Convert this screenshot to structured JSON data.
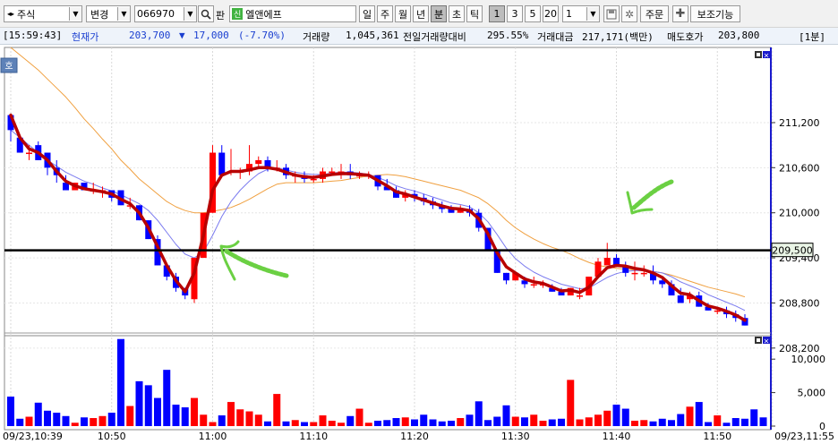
{
  "toolbar": {
    "market_type": "주식",
    "change_label": "변경",
    "stock_code": "066970",
    "search_label": "판",
    "credit_badge": "신",
    "stock_name": "엘앤에프",
    "periods": [
      "일",
      "주",
      "월",
      "년",
      "분",
      "초",
      "틱"
    ],
    "active_period": "분",
    "intervals": [
      "1",
      "3",
      "5",
      "20"
    ],
    "active_interval": "1",
    "interval_value": "1",
    "order_label": "주문",
    "aux_label": "보조기능"
  },
  "info": {
    "time": "[15:59:43]",
    "price_label": "현재가",
    "price": "203,700",
    "change_arrow": "▼",
    "change": "17,000",
    "change_pct": "(-7.70%)",
    "volume_label": "거래량",
    "volume": "1,045,361",
    "prev_ratio_label": "전일거래량대비",
    "prev_ratio": "295.55%",
    "amount_label": "거래대금",
    "amount": "217,171(백만)",
    "ask_label": "매도호가",
    "ask": "203,800",
    "timeframe": "[1분]"
  },
  "chart_data": {
    "type": "candlestick",
    "price_axis": {
      "ylim": [
        207900,
        212200
      ],
      "ticks": [
        208200,
        208800,
        209400,
        210000,
        210600,
        211200
      ],
      "tick_labels": [
        "208,200",
        "208,800",
        "209,400",
        "210,000",
        "210,600",
        "211,200"
      ]
    },
    "volume_axis": {
      "ylim": [
        0,
        13500
      ],
      "ticks": [
        0,
        5000,
        10000
      ],
      "tick_labels": [
        "0",
        "5,000",
        "10,000"
      ]
    },
    "x_labels": [
      "09/23,10:39",
      "10:50",
      "11:00",
      "11:10",
      "11:20",
      "11:30",
      "11:40",
      "11:50",
      "09/23,11:55"
    ],
    "x_label_minutes": [
      0,
      11,
      22,
      33,
      44,
      55,
      66,
      77,
      83
    ],
    "horizontal_line": {
      "value": 209500,
      "label": "209,500"
    },
    "corner_badge": "호",
    "candles": [
      {
        "o": 211300,
        "h": 211300,
        "l": 210950,
        "c": 211100
      },
      {
        "o": 211000,
        "h": 211000,
        "l": 210800,
        "c": 210800
      },
      {
        "o": 210800,
        "h": 210900,
        "l": 210700,
        "c": 210800
      },
      {
        "o": 210900,
        "h": 210950,
        "l": 210700,
        "c": 210700
      },
      {
        "o": 210800,
        "h": 210800,
        "l": 210500,
        "c": 210600
      },
      {
        "o": 210600,
        "h": 210700,
        "l": 210400,
        "c": 210500
      },
      {
        "o": 210400,
        "h": 210500,
        "l": 210300,
        "c": 210300
      },
      {
        "o": 210300,
        "h": 210400,
        "l": 210300,
        "c": 210400
      },
      {
        "o": 210400,
        "h": 210400,
        "l": 210300,
        "c": 210300
      },
      {
        "o": 210300,
        "h": 210400,
        "l": 210250,
        "c": 210300
      },
      {
        "o": 210300,
        "h": 210350,
        "l": 210200,
        "c": 210300
      },
      {
        "o": 210300,
        "h": 210300,
        "l": 210150,
        "c": 210200
      },
      {
        "o": 210300,
        "h": 210300,
        "l": 210100,
        "c": 210100
      },
      {
        "o": 210100,
        "h": 210200,
        "l": 210050,
        "c": 210100
      },
      {
        "o": 210100,
        "h": 210100,
        "l": 209900,
        "c": 209900
      },
      {
        "o": 209900,
        "h": 209900,
        "l": 209650,
        "c": 209650
      },
      {
        "o": 209650,
        "h": 209700,
        "l": 209300,
        "c": 209300
      },
      {
        "o": 209300,
        "h": 209300,
        "l": 209100,
        "c": 209150
      },
      {
        "o": 209150,
        "h": 209200,
        "l": 208950,
        "c": 209000
      },
      {
        "o": 209000,
        "h": 209000,
        "l": 208850,
        "c": 208900
      },
      {
        "o": 208850,
        "h": 209400,
        "l": 208800,
        "c": 209400
      },
      {
        "o": 209400,
        "h": 210000,
        "l": 209400,
        "c": 210000
      },
      {
        "o": 210000,
        "h": 210900,
        "l": 210000,
        "c": 210800
      },
      {
        "o": 210800,
        "h": 210900,
        "l": 210500,
        "c": 210500
      },
      {
        "o": 210550,
        "h": 210850,
        "l": 210500,
        "c": 210550
      },
      {
        "o": 210550,
        "h": 210600,
        "l": 210450,
        "c": 210550
      },
      {
        "o": 210550,
        "h": 210900,
        "l": 210500,
        "c": 210650
      },
      {
        "o": 210650,
        "h": 210750,
        "l": 210600,
        "c": 210700
      },
      {
        "o": 210700,
        "h": 210750,
        "l": 210550,
        "c": 210600
      },
      {
        "o": 210600,
        "h": 210700,
        "l": 210550,
        "c": 210600
      },
      {
        "o": 210600,
        "h": 210650,
        "l": 210450,
        "c": 210500
      },
      {
        "o": 210500,
        "h": 210550,
        "l": 210400,
        "c": 210500
      },
      {
        "o": 210500,
        "h": 210550,
        "l": 210400,
        "c": 210450
      },
      {
        "o": 210450,
        "h": 210500,
        "l": 210400,
        "c": 210450
      },
      {
        "o": 210450,
        "h": 210600,
        "l": 210400,
        "c": 210550
      },
      {
        "o": 210550,
        "h": 210600,
        "l": 210500,
        "c": 210550
      },
      {
        "o": 210550,
        "h": 210650,
        "l": 210450,
        "c": 210550
      },
      {
        "o": 210550,
        "h": 210650,
        "l": 210450,
        "c": 210500
      },
      {
        "o": 210500,
        "h": 210550,
        "l": 210450,
        "c": 210500
      },
      {
        "o": 210500,
        "h": 210550,
        "l": 210450,
        "c": 210500
      },
      {
        "o": 210500,
        "h": 210500,
        "l": 210300,
        "c": 210350
      },
      {
        "o": 210350,
        "h": 210450,
        "l": 210300,
        "c": 210300
      },
      {
        "o": 210300,
        "h": 210350,
        "l": 210200,
        "c": 210200
      },
      {
        "o": 210200,
        "h": 210300,
        "l": 210150,
        "c": 210250
      },
      {
        "o": 210250,
        "h": 210300,
        "l": 210150,
        "c": 210200
      },
      {
        "o": 210200,
        "h": 210250,
        "l": 210100,
        "c": 210150
      },
      {
        "o": 210150,
        "h": 210200,
        "l": 210050,
        "c": 210100
      },
      {
        "o": 210100,
        "h": 210150,
        "l": 210000,
        "c": 210050
      },
      {
        "o": 210050,
        "h": 210100,
        "l": 210000,
        "c": 210000
      },
      {
        "o": 210000,
        "h": 210100,
        "l": 210000,
        "c": 210050
      },
      {
        "o": 210050,
        "h": 210100,
        "l": 209950,
        "c": 210000
      },
      {
        "o": 210000,
        "h": 210050,
        "l": 209750,
        "c": 209800
      },
      {
        "o": 209800,
        "h": 209800,
        "l": 209500,
        "c": 209500
      },
      {
        "o": 209500,
        "h": 209500,
        "l": 209200,
        "c": 209200
      },
      {
        "o": 209200,
        "h": 209200,
        "l": 209050,
        "c": 209100
      },
      {
        "o": 209100,
        "h": 209200,
        "l": 209100,
        "c": 209200
      },
      {
        "o": 209100,
        "h": 209150,
        "l": 209000,
        "c": 209050
      },
      {
        "o": 209050,
        "h": 209150,
        "l": 209000,
        "c": 209050
      },
      {
        "o": 209050,
        "h": 209100,
        "l": 209000,
        "c": 209050
      },
      {
        "o": 209000,
        "h": 209050,
        "l": 208950,
        "c": 208950
      },
      {
        "o": 208950,
        "h": 209000,
        "l": 208900,
        "c": 208900
      },
      {
        "o": 208900,
        "h": 209000,
        "l": 208900,
        "c": 209000
      },
      {
        "o": 208900,
        "h": 209000,
        "l": 208850,
        "c": 208900
      },
      {
        "o": 208900,
        "h": 209150,
        "l": 208900,
        "c": 209150
      },
      {
        "o": 209150,
        "h": 209400,
        "l": 209150,
        "c": 209350
      },
      {
        "o": 209300,
        "h": 209600,
        "l": 209300,
        "c": 209400
      },
      {
        "o": 209400,
        "h": 209450,
        "l": 209300,
        "c": 209300
      },
      {
        "o": 209300,
        "h": 209350,
        "l": 209150,
        "c": 209200
      },
      {
        "o": 209200,
        "h": 209350,
        "l": 209100,
        "c": 209200
      },
      {
        "o": 209200,
        "h": 209300,
        "l": 209150,
        "c": 209200
      },
      {
        "o": 209200,
        "h": 209300,
        "l": 209050,
        "c": 209100
      },
      {
        "o": 209100,
        "h": 209150,
        "l": 209000,
        "c": 209050
      },
      {
        "o": 209050,
        "h": 209100,
        "l": 208900,
        "c": 208900
      },
      {
        "o": 208900,
        "h": 209000,
        "l": 208800,
        "c": 208800
      },
      {
        "o": 208850,
        "h": 208950,
        "l": 208800,
        "c": 208900
      },
      {
        "o": 208900,
        "h": 208950,
        "l": 208750,
        "c": 208750
      },
      {
        "o": 208750,
        "h": 208800,
        "l": 208700,
        "c": 208700
      },
      {
        "o": 208700,
        "h": 208750,
        "l": 208650,
        "c": 208700
      },
      {
        "o": 208700,
        "h": 208750,
        "l": 208600,
        "c": 208650
      },
      {
        "o": 208650,
        "h": 208700,
        "l": 208550,
        "c": 208600
      },
      {
        "o": 208600,
        "h": 208650,
        "l": 208500,
        "c": 208500
      }
    ],
    "volume": [
      4400,
      1100,
      1400,
      3500,
      2300,
      2000,
      1500,
      500,
      1300,
      1200,
      1500,
      2000,
      13000,
      3000,
      6700,
      6100,
      4200,
      8400,
      3200,
      2800,
      4200,
      1700,
      600,
      1600,
      3600,
      2500,
      2200,
      1700,
      700,
      4800,
      700,
      900,
      600,
      600,
      1600,
      800,
      500,
      1500,
      2600,
      500,
      800,
      900,
      1200,
      1300,
      1000,
      1700,
      1000,
      700,
      800,
      1200,
      1700,
      3700,
      900,
      1400,
      3100,
      1400,
      1300,
      1700,
      800,
      1000,
      1100,
      6900,
      1000,
      1300,
      1700,
      2300,
      3200,
      2600,
      800,
      900,
      700,
      1100,
      900,
      1800,
      2900,
      3600,
      600,
      1600,
      500,
      1200,
      1100,
      2500,
      1300
    ],
    "ma_thick_red": [
      211300,
      211000,
      210850,
      210800,
      210700,
      210550,
      210420,
      210360,
      210320,
      210300,
      210280,
      210250,
      210180,
      210120,
      210000,
      209800,
      209550,
      209300,
      209100,
      208950,
      209200,
      209700,
      210300,
      210500,
      210550,
      210550,
      210570,
      210600,
      210600,
      210580,
      210540,
      210500,
      210480,
      210470,
      210490,
      210510,
      210520,
      210520,
      210510,
      210500,
      210430,
      210360,
      210280,
      210250,
      210210,
      210170,
      210130,
      210090,
      210060,
      210050,
      210030,
      209920,
      209720,
      209470,
      209280,
      209200,
      209120,
      209080,
      209060,
      209010,
      208960,
      208970,
      208940,
      209010,
      209150,
      209270,
      209300,
      209290,
      209260,
      209240,
      209200,
      209140,
      209030,
      208930,
      208910,
      208830,
      208760,
      208730,
      208690,
      208640,
      208570
    ],
    "ma_blue": [
      211100,
      211000,
      210900,
      210800,
      210700,
      210620,
      210540,
      210480,
      210420,
      210380,
      210330,
      210290,
      210240,
      210180,
      210120,
      210030,
      209900,
      209740,
      209580,
      209450,
      209400,
      209480,
      209700,
      209950,
      210150,
      210300,
      210420,
      210520,
      210580,
      210600,
      210570,
      210540,
      210520,
      210510,
      210510,
      210530,
      210540,
      210540,
      210530,
      210510,
      210470,
      210420,
      210360,
      210320,
      210290,
      210250,
      210210,
      210170,
      210130,
      210110,
      210080,
      210000,
      209880,
      209710,
      209530,
      209390,
      209290,
      209210,
      209150,
      209100,
      209050,
      209020,
      208990,
      209000,
      209070,
      209140,
      209190,
      209220,
      209230,
      209230,
      209220,
      209200,
      209150,
      209080,
      209030,
      208980,
      208910,
      208860,
      208810,
      208760,
      208700
    ],
    "ma_orange": [
      212200,
      212100,
      212000,
      211900,
      211780,
      211660,
      211540,
      211400,
      211250,
      211120,
      210980,
      210850,
      210700,
      210580,
      210450,
      210350,
      210250,
      210150,
      210080,
      210030,
      210000,
      210000,
      210020,
      210040,
      210070,
      210120,
      210180,
      210250,
      210320,
      210380,
      210400,
      210400,
      210400,
      210400,
      210410,
      210420,
      210430,
      210450,
      210470,
      210490,
      210500,
      210510,
      210500,
      210480,
      210450,
      210420,
      210390,
      210360,
      210330,
      210300,
      210250,
      210200,
      210120,
      210020,
      209900,
      209800,
      209720,
      209650,
      209590,
      209540,
      209500,
      209450,
      209390,
      209340,
      209300,
      209280,
      209260,
      209250,
      209240,
      209230,
      209220,
      209200,
      209170,
      209130,
      209090,
      209050,
      209010,
      208980,
      208950,
      208920,
      208880
    ]
  }
}
